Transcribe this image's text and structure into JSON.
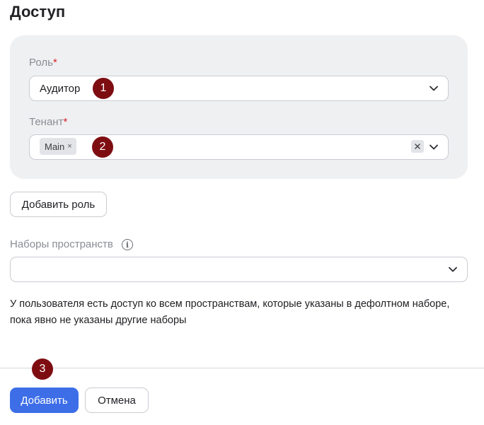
{
  "header": {
    "title": "Доступ"
  },
  "role_block": {
    "role": {
      "label": "Роль",
      "required_mark": "*",
      "value": "Аудитор"
    },
    "tenant": {
      "label": "Тенант",
      "required_mark": "*",
      "tags": [
        "Main"
      ],
      "tag_remove_glyph": "×"
    }
  },
  "add_role_label": "Добавить роль",
  "spaces": {
    "label": "Наборы пространств",
    "value": ""
  },
  "note": "У пользователя есть доступ ко всем пространствам, которые указаны в дефолтном наборе, пока явно не указаны другие наборы",
  "footer": {
    "submit_label": "Добавить",
    "cancel_label": "Отмена"
  },
  "markers": [
    "1",
    "2",
    "3"
  ],
  "colors": {
    "accent": "#3d6ee8",
    "marker": "#7e0d12",
    "required": "#d8232a",
    "card_bg": "#eff0f2"
  }
}
